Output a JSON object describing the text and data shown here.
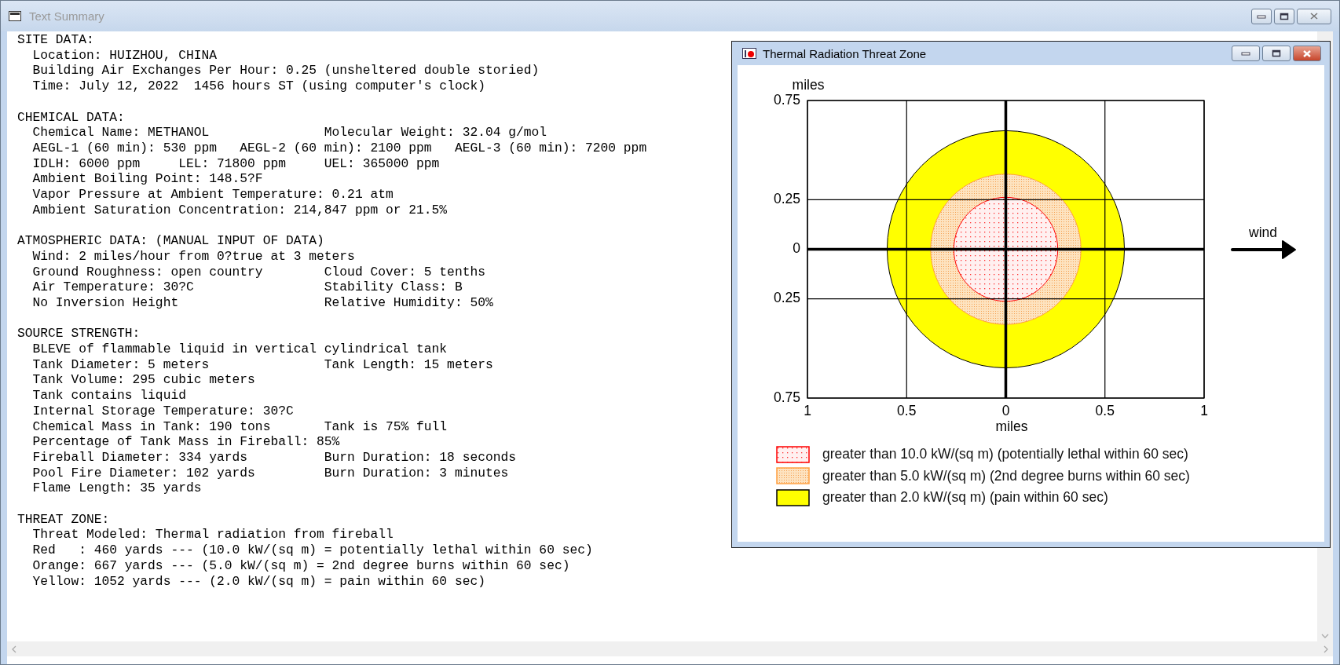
{
  "window": {
    "title": "Text Summary"
  },
  "sections": [
    {
      "heading": "SITE DATA:",
      "lines": [
        {
          "text": "Location: HUIZHOU, CHINA"
        },
        {
          "text": "Building Air Exchanges Per Hour: 0.25 (unsheltered double storied)"
        },
        {
          "text": "Time: July 12, 2022  1456 hours ST (using computer's clock)"
        }
      ]
    },
    {
      "heading": "CHEMICAL DATA:",
      "lines": [
        {
          "text": "Chemical Name: METHANOL",
          "right": "Molecular Weight: 32.04 g/mol"
        },
        {
          "text": "AEGL-1 (60 min): 530 ppm   AEGL-2 (60 min): 2100 ppm   AEGL-3 (60 min): 7200 ppm"
        },
        {
          "text": "IDLH: 6000 ppm     LEL: 71800 ppm",
          "right": "UEL: 365000 ppm"
        },
        {
          "text": "Ambient Boiling Point: 148.5?F"
        },
        {
          "text": "Vapor Pressure at Ambient Temperature: 0.21 atm"
        },
        {
          "text": "Ambient Saturation Concentration: 214,847 ppm or 21.5%"
        }
      ]
    },
    {
      "heading": "ATMOSPHERIC DATA: (MANUAL INPUT OF DATA)",
      "lines": [
        {
          "text": "Wind: 2 miles/hour from 0?true at 3 meters"
        },
        {
          "text": "Ground Roughness: open country",
          "right": "Cloud Cover: 5 tenths"
        },
        {
          "text": "Air Temperature: 30?C",
          "right": "Stability Class: B"
        },
        {
          "text": "No Inversion Height",
          "right": "Relative Humidity: 50%"
        }
      ]
    },
    {
      "heading": "SOURCE STRENGTH:",
      "lines": [
        {
          "text": "BLEVE of flammable liquid in vertical cylindrical tank"
        },
        {
          "text": "Tank Diameter: 5 meters",
          "right": "Tank Length: 15 meters"
        },
        {
          "text": "Tank Volume: 295 cubic meters"
        },
        {
          "text": "Tank contains liquid"
        },
        {
          "text": "Internal Storage Temperature: 30?C"
        },
        {
          "text": "Chemical Mass in Tank: 190 tons",
          "right": "Tank is 75% full"
        },
        {
          "text": "Percentage of Tank Mass in Fireball: 85%"
        },
        {
          "text": "Fireball Diameter: 334 yards",
          "right": "Burn Duration: 18 seconds"
        },
        {
          "text": "Pool Fire Diameter: 102 yards",
          "right": "Burn Duration: 3 minutes"
        },
        {
          "text": "Flame Length: 35 yards"
        }
      ]
    },
    {
      "heading": "THREAT ZONE:",
      "lines": [
        {
          "text": "Threat Modeled: Thermal radiation from fireball"
        },
        {
          "text": "Red   : 460 yards --- (10.0 kW/(sq m) = potentially lethal within 60 sec)"
        },
        {
          "text": "Orange: 667 yards --- (5.0 kW/(sq m) = 2nd degree burns within 60 sec)"
        },
        {
          "text": "Yellow: 1052 yards --- (2.0 kW/(sq m) = pain within 60 sec)"
        }
      ]
    }
  ],
  "chart_window": {
    "title": "Thermal Radiation Threat Zone",
    "y_unit": "miles",
    "y_ticks": [
      "0.75",
      "0.25",
      "0",
      "0.25",
      "0.75"
    ],
    "x_ticks": [
      "1",
      "0.5",
      "0",
      "0.5",
      "1"
    ],
    "x_unit": "miles",
    "wind_label": "wind",
    "legend": [
      {
        "label": "greater than 10.0 kW/(sq m) (potentially lethal within 60 sec)",
        "color": "#ff0000",
        "kind": "dots"
      },
      {
        "label": "greater than 5.0 kW/(sq m) (2nd degree burns within 60 sec)",
        "color": "#ffa040",
        "kind": "fine_dots"
      },
      {
        "label": "greater than 2.0 kW/(sq m) (pain within 60 sec)",
        "color": "#ffff00",
        "kind": "solid"
      }
    ]
  }
}
